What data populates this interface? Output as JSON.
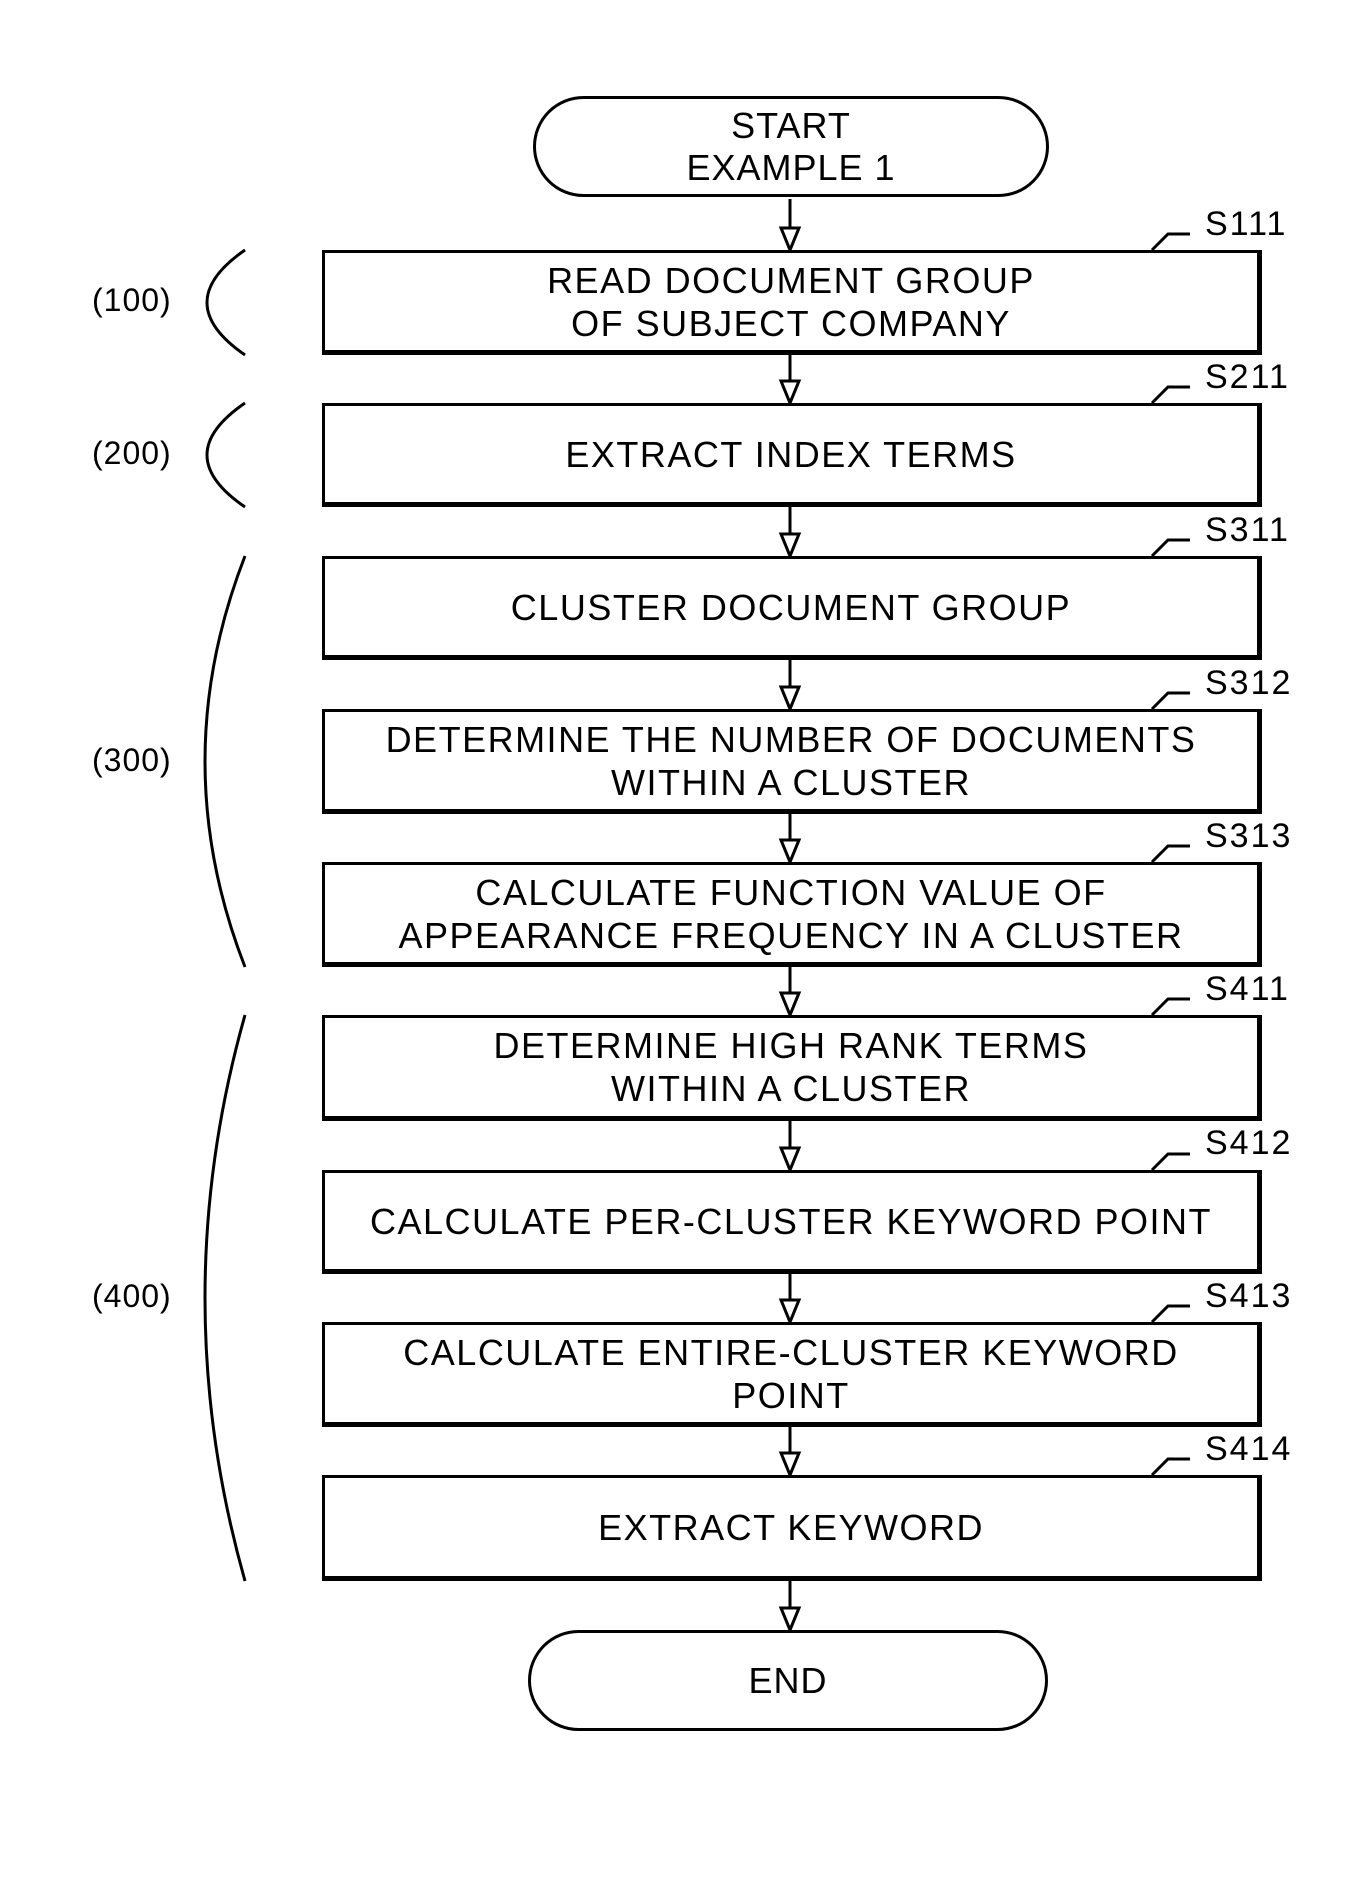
{
  "flowchart": {
    "start": {
      "lines": [
        "START",
        "EXAMPLE 1"
      ]
    },
    "end": {
      "lines": [
        "END"
      ]
    },
    "steps": [
      {
        "id": "S111",
        "lines": [
          "READ DOCUMENT GROUP",
          "OF SUBJECT COMPANY"
        ]
      },
      {
        "id": "S211",
        "lines": [
          "EXTRACT INDEX TERMS"
        ]
      },
      {
        "id": "S311",
        "lines": [
          "CLUSTER DOCUMENT GROUP"
        ]
      },
      {
        "id": "S312",
        "lines": [
          "DETERMINE THE NUMBER OF DOCUMENTS",
          "WITHIN A CLUSTER"
        ]
      },
      {
        "id": "S313",
        "lines": [
          "CALCULATE FUNCTION VALUE OF",
          "APPEARANCE FREQUENCY IN A CLUSTER"
        ]
      },
      {
        "id": "S411",
        "lines": [
          "DETERMINE HIGH RANK TERMS",
          "WITHIN A CLUSTER"
        ]
      },
      {
        "id": "S412",
        "lines": [
          "CALCULATE PER-CLUSTER KEYWORD POINT"
        ]
      },
      {
        "id": "S413",
        "lines": [
          "CALCULATE ENTIRE-CLUSTER KEYWORD",
          "POINT"
        ]
      },
      {
        "id": "S414",
        "lines": [
          "EXTRACT KEYWORD"
        ]
      }
    ],
    "groups": [
      {
        "label": "(100)",
        "steps": [
          "S111"
        ]
      },
      {
        "label": "(200)",
        "steps": [
          "S211"
        ]
      },
      {
        "label": "(300)",
        "steps": [
          "S311",
          "S312",
          "S313"
        ]
      },
      {
        "label": "(400)",
        "steps": [
          "S411",
          "S412",
          "S413",
          "S414"
        ]
      }
    ]
  }
}
